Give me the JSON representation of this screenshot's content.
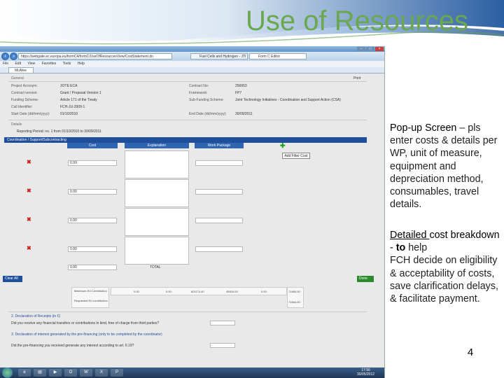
{
  "slide": {
    "title": "Use of Resources",
    "number": "4",
    "popup_lead": "Pop-up Screen",
    "popup_rest": " – pls enter costs & details per WP, unit of measure, equipment and depreciation method, consumables, travel details.",
    "detail_underlined": "Detailed ",
    "detail_lead": "cost breakdown - ",
    "detail_to": "to",
    "detail_help": " help",
    "detail_rest": "FCH decide on eligibility & acceptability of costs, save clarification delays, & facilitate payment."
  },
  "browser": {
    "url": "https://webgate.ec.europa.eu/formC4/formC/UseOfResourcesView/CostStatement.do",
    "tab1": "Fuel Cells and Hydrogen - JTI",
    "tab2": "Form C Editor",
    "menu": [
      "File",
      "Edit",
      "View",
      "Favorites",
      "Tools",
      "Help"
    ],
    "fav": "McAfee"
  },
  "form": {
    "general": "General",
    "print": "Print",
    "fields": [
      {
        "label": "Project Acronym:",
        "value": "JOTE ECA"
      },
      {
        "label": "Contract version:",
        "value": "Grant / Proposal Version 1"
      },
      {
        "label": "Funding Scheme:",
        "value": "Article 171 of the Treaty"
      },
      {
        "label": "Call Identifier:",
        "value": "FCH-JU-2009-1"
      },
      {
        "label": "Start Date (dd/mm/yyyy):",
        "value": "01/10/2010"
      }
    ],
    "fields_right": [
      {
        "label": "Contract No:",
        "value": "256653"
      },
      {
        "label": "Framework:",
        "value": "FP7"
      },
      {
        "label": "Sub-Funding Scheme:",
        "value": "Joint Technology Initiatives - Coordination and Support Action (CSA)"
      },
      {
        "label": "End Date (dd/mm/yyyy):",
        "value": "30/09/2011"
      }
    ],
    "details": "Details",
    "period": "Reporting Period:  no. 1  from 01/10/2010  to 30/09/2011",
    "section": "Coordination / Support/Subcontracting",
    "columns": [
      "Cost",
      "Explanation",
      "Work Package"
    ],
    "add_button": "Add Filter Cost",
    "cost_values": [
      "0.00",
      "0.00",
      "0.00",
      "0.00",
      "0.00"
    ],
    "total": "TOTAL",
    "clear_button": "Clear All",
    "done_button": "Done",
    "summary_labels": [
      "Maximum EU Contribution",
      "Requested EU contribution"
    ],
    "summary_values": [
      "0.00",
      "0.00",
      "601174.40",
      "45004.00",
      "0.00",
      "71664.00",
      "71664.00"
    ],
    "decl1": "2. Declaration of Receipts (in €)",
    "decl1_text": "Did you receive any financial transfers or contributions in kind, free of charge from third parties?",
    "decl2": "3. Declaration of interest generated by the pre-financing (only to be completed by the coordinator)",
    "decl2_text": "Did the pre-financing you received generate any interest according to art. II.19?"
  },
  "taskbar": {
    "time": "17:56",
    "date": "30/05/2012"
  }
}
